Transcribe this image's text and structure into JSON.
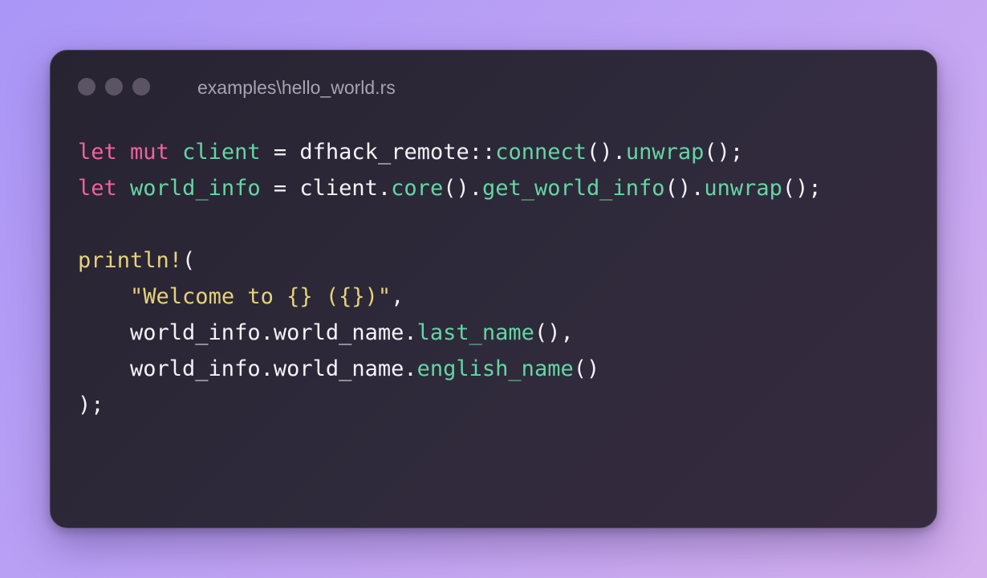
{
  "colors": {
    "keyword": "#f062a0",
    "variable": "#63d6a3",
    "function": "#63d6a3",
    "macro": "#e6d27a",
    "string": "#e6d27a",
    "plain": "#f5f3f8",
    "window_dots": "#5b5465",
    "filename": "#a8a3b1"
  },
  "window": {
    "filename": "examples\\hello_world.rs",
    "dots": [
      "window-dot",
      "window-dot",
      "window-dot"
    ]
  },
  "code": {
    "lines": [
      [
        {
          "t": "kw",
          "s": "let"
        },
        {
          "t": "plain",
          "s": " "
        },
        {
          "t": "kw",
          "s": "mut"
        },
        {
          "t": "plain",
          "s": " "
        },
        {
          "t": "var",
          "s": "client"
        },
        {
          "t": "plain",
          "s": " = dfhack_remote::"
        },
        {
          "t": "fn",
          "s": "connect"
        },
        {
          "t": "plain",
          "s": "()."
        },
        {
          "t": "fn",
          "s": "unwrap"
        },
        {
          "t": "plain",
          "s": "();"
        }
      ],
      [
        {
          "t": "kw",
          "s": "let"
        },
        {
          "t": "plain",
          "s": " "
        },
        {
          "t": "var",
          "s": "world_info"
        },
        {
          "t": "plain",
          "s": " = client."
        },
        {
          "t": "fn",
          "s": "core"
        },
        {
          "t": "plain",
          "s": "()."
        },
        {
          "t": "fn",
          "s": "get_world_info"
        },
        {
          "t": "plain",
          "s": "()."
        },
        {
          "t": "fn",
          "s": "unwrap"
        },
        {
          "t": "plain",
          "s": "();"
        }
      ],
      [],
      [
        {
          "t": "mac",
          "s": "println!"
        },
        {
          "t": "plain",
          "s": "("
        }
      ],
      [
        {
          "t": "plain",
          "s": "    "
        },
        {
          "t": "str",
          "s": "\"Welcome to {} ({})\""
        },
        {
          "t": "plain",
          "s": ","
        }
      ],
      [
        {
          "t": "plain",
          "s": "    world_info.world_name."
        },
        {
          "t": "fn",
          "s": "last_name"
        },
        {
          "t": "plain",
          "s": "(),"
        }
      ],
      [
        {
          "t": "plain",
          "s": "    world_info.world_name."
        },
        {
          "t": "fn",
          "s": "english_name"
        },
        {
          "t": "plain",
          "s": "()"
        }
      ],
      [
        {
          "t": "plain",
          "s": ");"
        }
      ]
    ]
  }
}
